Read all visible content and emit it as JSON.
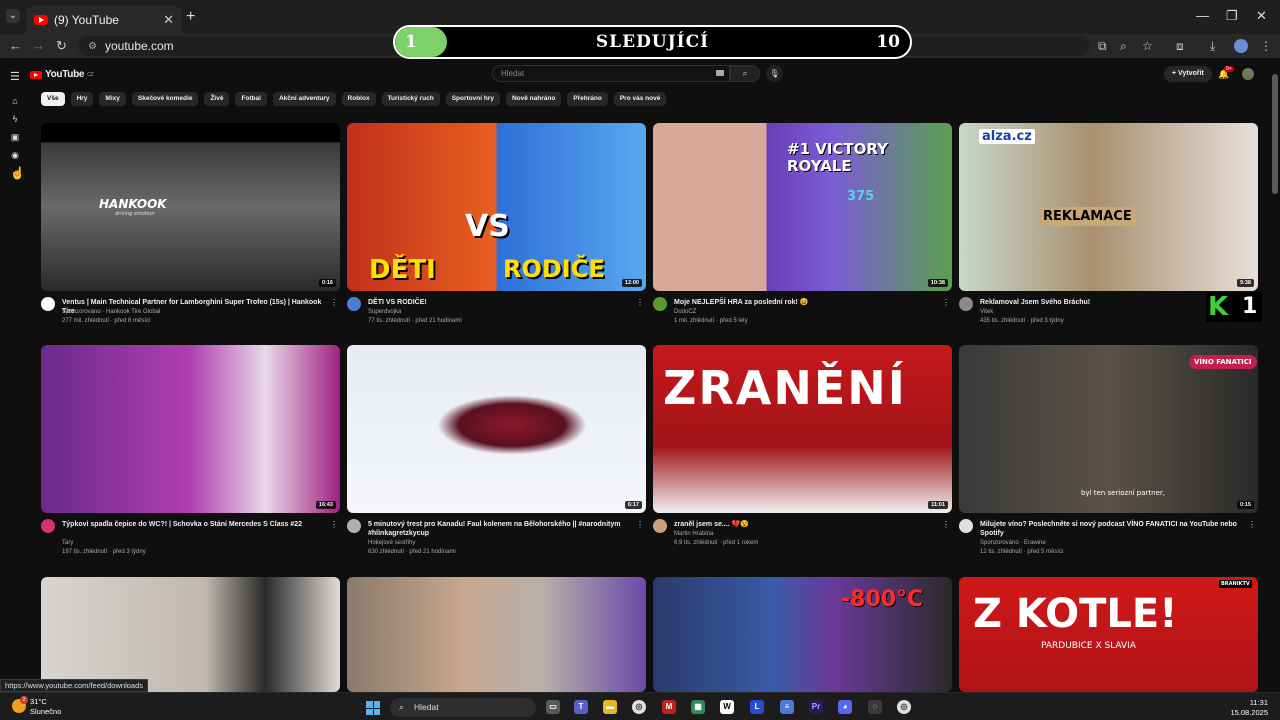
{
  "browser": {
    "tab_title": "(9) YouTube",
    "url": "youtube.com",
    "status_url": "https://www.youtube.com/feed/downloads"
  },
  "banner": {
    "left_number": "1",
    "title": "SLEDUJÍCÍ",
    "right_number": "10",
    "progress": 0.1
  },
  "youtube": {
    "logo_text": "YouTube",
    "logo_country": "CZ",
    "search_placeholder": "Hledat",
    "create_label": "Vytvořit",
    "notification_count": "9+",
    "chips": [
      "Vše",
      "Hry",
      "Mixy",
      "Skečové komedie",
      "Živě",
      "Fotbal",
      "Akční adventury",
      "Roblox",
      "Turistický ruch",
      "Sportovní hry",
      "Nově nahráno",
      "Přehráno",
      "Pro vás nové"
    ]
  },
  "videos": [
    {
      "title": "Ventus | Main Technical Partner for Lamborghini Super Trofeo (15s) | Hankook Tire",
      "channel": "Sponzorováno · Hankook Tire Global",
      "stats": "277 mil. zhlédnutí · před 8 měsíci",
      "duration": "0:16",
      "thumb_text": "HANKOOK",
      "thumb_sub": "driving emotion"
    },
    {
      "title": "DĚTI VS RODIČE!",
      "channel": "Superdvojka",
      "stats": "77 tis. zhlédnutí · před 21 hodinami",
      "duration": "12:00",
      "thumb_text": "DĚTI",
      "thumb_text2": "RODIČE",
      "thumb_vs": "VS"
    },
    {
      "title": "Moje NEJLEPŠÍ HRA za poslední rok! 😆",
      "channel": "DodoCZ",
      "stats": "1 mil. zhlédnutí · před 5 lety",
      "duration": "10:38",
      "thumb_text": "#1 VICTORY ROYALE",
      "thumb_sub": "375"
    },
    {
      "title": "Reklamoval Jsem Svého Bráchu!",
      "channel": "Vitek",
      "stats": "435 tis. zhlédnutí · před 3 týdny",
      "duration": "9:38",
      "thumb_text": "REKLAMACE",
      "thumb_sub": "alza.cz"
    },
    {
      "title": "Týpkovi spadla čepice do WC?! | Schovka o Stání Mercedes S Class #22",
      "channel": "Tary",
      "stats": "197 tis. zhlédnutí · před 3 týdny",
      "duration": "16:43"
    },
    {
      "title": "5 minutový trest pro Kanadu! Faul kolenem na Bělohorského || #narodnitym #hlinkagretzkycup",
      "channel": "Hokejové sestřihy",
      "stats": "630 zhlédnutí · před 21 hodinami",
      "duration": "6:17"
    },
    {
      "title": "zraněl jsem se.... 💔😵",
      "channel": "Martin Hrabina",
      "stats": "6,9 tis. zhlédnutí · před 1 rokem",
      "duration": "11:01",
      "thumb_text": "ZRANĚNÍ"
    },
    {
      "title": "Milujete víno? Poslechněte si nový podcast VÍNO FANATICI na YouTube nebo Spotify",
      "channel": "Sponzorováno · Erawine",
      "stats": "12 tis. zhlédnutí · před 5 měsíci",
      "duration": "0:15",
      "thumb_text": "VÍNO FANATICI",
      "thumb_sub": "byl ten seriozní partner,"
    }
  ],
  "row3_thumbs": [
    {
      "text": ""
    },
    {
      "text": ""
    },
    {
      "text": "-800°C"
    },
    {
      "text": "Z KOTLE!",
      "sub": "PARDUBICE X SLAVIA",
      "badge": "BRANIKTV"
    }
  ],
  "taskbar": {
    "temperature": "31°C",
    "weather": "Slunečno",
    "search_label": "Hledat",
    "time": "11:31",
    "date": "15.08.2025",
    "weather_badge": "2"
  },
  "k_logo": {
    "letter": "K",
    "number": "1"
  },
  "colors": {
    "background": "#0f0f0f",
    "accent": "#ff0000",
    "banner_fill": "#7ed06a"
  }
}
